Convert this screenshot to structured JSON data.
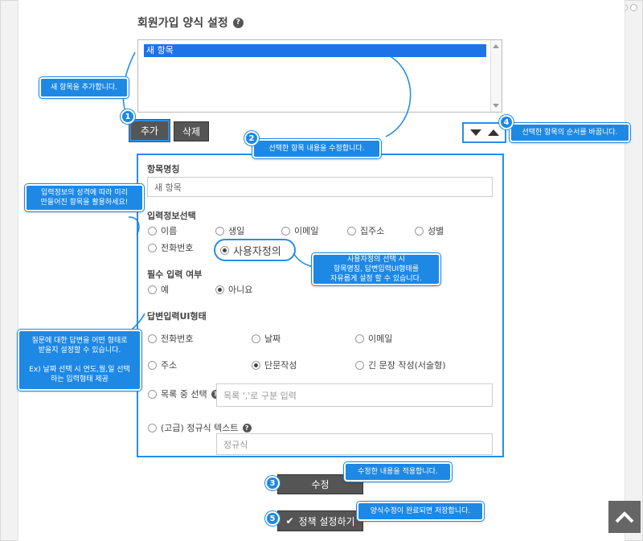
{
  "page": {
    "title": "회원가입 양식 설정",
    "help_icon": "?"
  },
  "item_list": {
    "items": [
      "새 항목"
    ]
  },
  "buttons": {
    "add": "추가",
    "delete": "삭제",
    "edit": "수정",
    "save_policy": "정책 설정하기",
    "order_icons": [
      "triangle-down-icon",
      "triangle-up-icon"
    ]
  },
  "form": {
    "item_name_label": "항목명칭",
    "item_name_value": "새 항목",
    "input_info_label": "입력정보선택",
    "input_info_options": [
      "이름",
      "생일",
      "이메일",
      "집주소",
      "성별",
      "전화번호",
      "사용자정의"
    ],
    "input_info_selected": "사용자정의",
    "required_label": "필수 입력 여부",
    "required_options": [
      "예",
      "아니요"
    ],
    "required_selected": "아니요",
    "ui_type_label": "답변입력UI형태",
    "ui_type_options": [
      "전화번호",
      "날짜",
      "이메일",
      "주소",
      "단문작성",
      "긴 문장 작성(서술형)",
      "목록 중 선택",
      "(고급) 정규식 텍스트"
    ],
    "ui_type_selected": "단문작성",
    "list_placeholder": "목록 ','로 구분 입력",
    "regex_placeholder": "정규식"
  },
  "tooltips": {
    "add_item": "새 항목을 추가합니다.",
    "edit_selected": "선택한 항목 내용을 수정합니다.",
    "reorder": "선택한 항목의 순서를 바꿉니다.",
    "preset_items": "입력정보의 성격에 따라 미리\n만들어진 항목을 활용하세요!",
    "custom_info": "사용자정의 선택 시\n항목명칭, 답변입력UI형태를\n자유롭게 설정 할 수 있습니다.",
    "ui_type": "질문에 대한 답변을 어떤 형태로\n받을지 설정할 수 있습니다.\n\nEx) 날짜 선택 시 연도,월,일 선택\n하는 입력형태 제공",
    "apply": "수정한 내용을 적용합니다.",
    "save_done": "양식수정이 완료되면 저장합니다."
  },
  "badges": [
    "1",
    "2",
    "3",
    "4",
    "5"
  ],
  "colors": {
    "accent": "#1e88e5",
    "selection": "#1e73e8",
    "button": "#555555"
  }
}
